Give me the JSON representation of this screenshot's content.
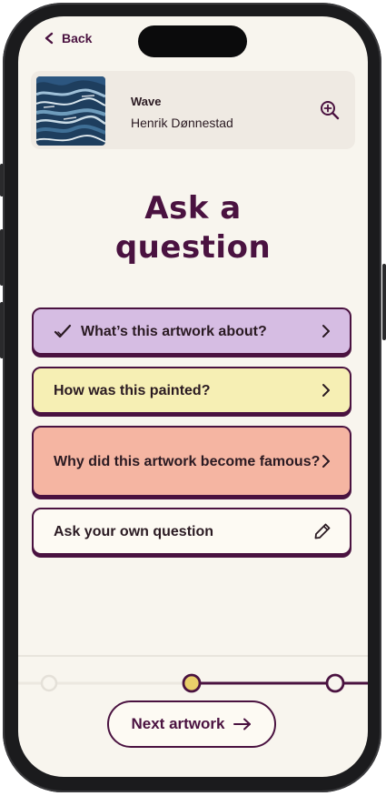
{
  "nav": {
    "back_label": "Back"
  },
  "artwork": {
    "title": "Wave",
    "artist": "Henrik Dønnestad"
  },
  "page": {
    "heading_line1": "Ask a",
    "heading_line2": "question"
  },
  "questions": [
    {
      "label": "What’s this artwork about?",
      "state": "answered",
      "color": "#d6bde3"
    },
    {
      "label": "How was this painted?",
      "state": "open",
      "color": "#f6efb4"
    },
    {
      "label": "Why did this artwork become famous?",
      "state": "open",
      "color": "#f5b5a2"
    }
  ],
  "own_question": {
    "label": "Ask your own question"
  },
  "progress": {
    "steps": 3,
    "current": 2
  },
  "footer": {
    "next_label": "Next artwork"
  },
  "colors": {
    "accent": "#4a1240",
    "background": "#f8f5ee",
    "current_step": "#e9cf6a"
  }
}
